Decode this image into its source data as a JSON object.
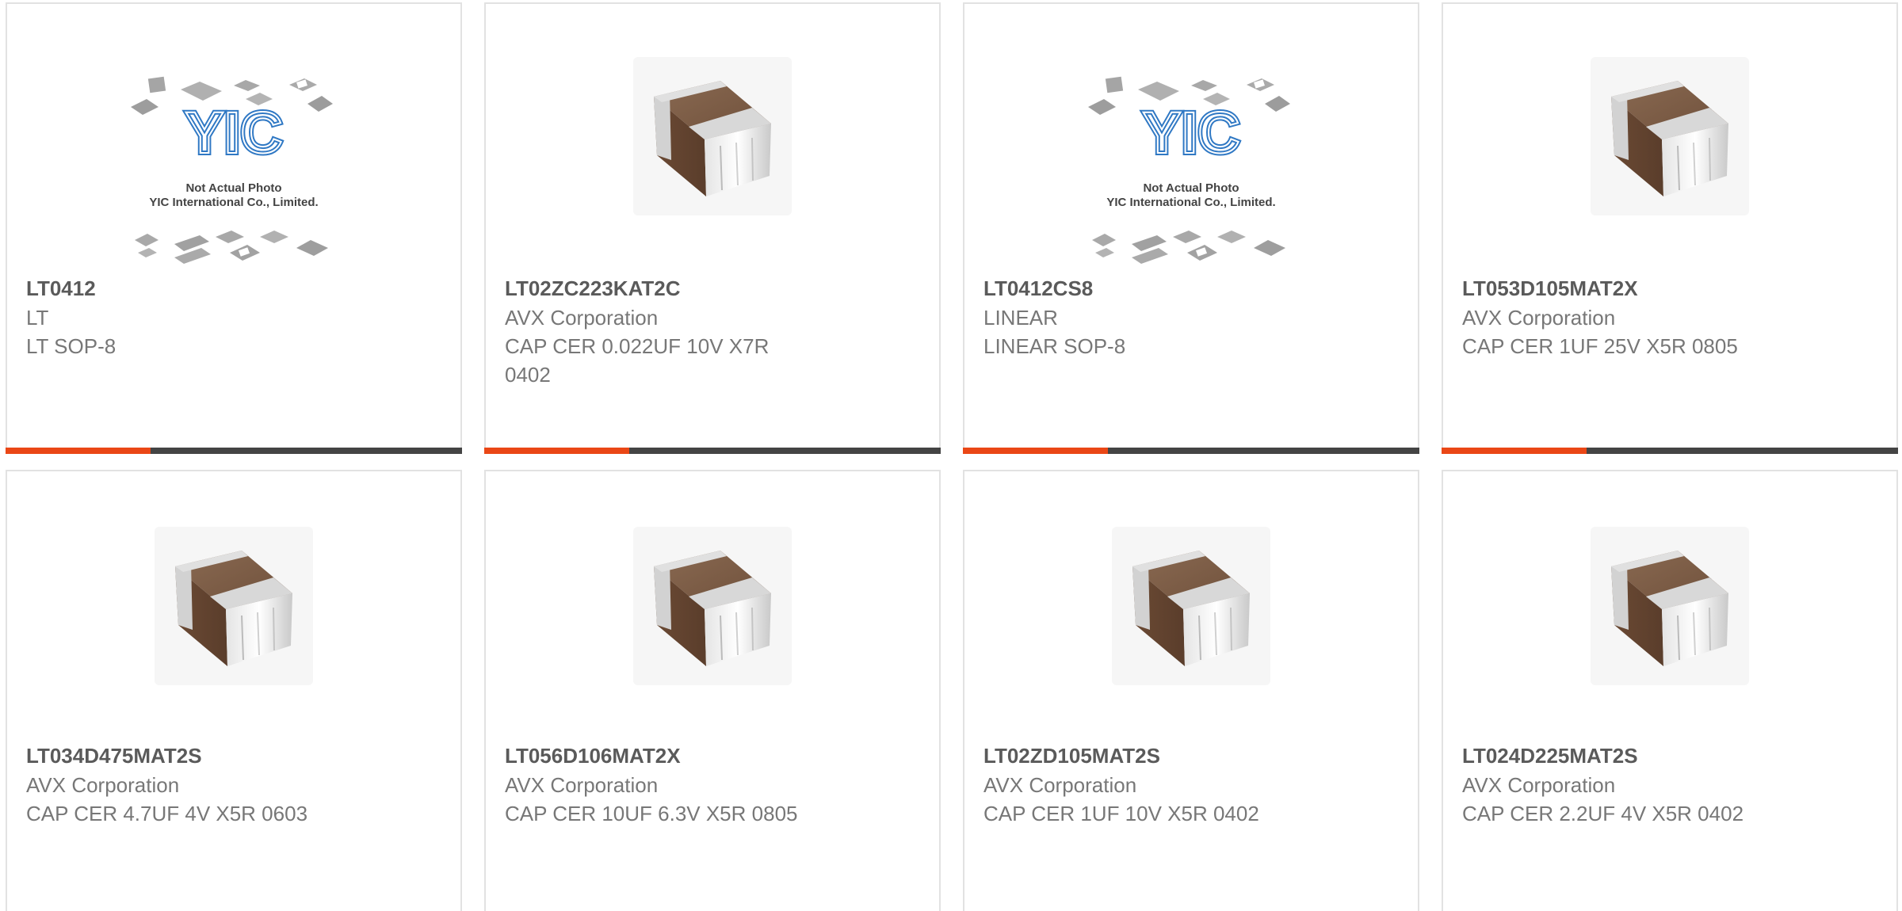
{
  "theme": {
    "accent": "#ea4716",
    "bar": "#444444",
    "border": "#e2e2e2",
    "part_text": "#5a5a5a",
    "body_text": "#777777"
  },
  "products": [
    {
      "part": "LT0412",
      "maker": "LT",
      "desc": "LT SOP-8",
      "image": "yic-not-actual-photo",
      "photo_caption_1": "Not Actual Photo",
      "photo_caption_2": "YIC International Co., Limited."
    },
    {
      "part": "LT02ZC223KAT2C",
      "maker": "AVX Corporation",
      "desc": "CAP CER 0.022UF 10V X7R 0402",
      "image": "ceramic-capacitor"
    },
    {
      "part": "LT0412CS8",
      "maker": "LINEAR",
      "desc": "LINEAR SOP-8",
      "image": "yic-not-actual-photo",
      "photo_caption_1": "Not Actual Photo",
      "photo_caption_2": "YIC International Co., Limited."
    },
    {
      "part": "LT053D105MAT2X",
      "maker": "AVX Corporation",
      "desc": "CAP CER 1UF 25V X5R 0805",
      "image": "ceramic-capacitor"
    },
    {
      "part": "LT034D475MAT2S",
      "maker": "AVX Corporation",
      "desc": "CAP CER 4.7UF 4V X5R 0603",
      "image": "ceramic-capacitor"
    },
    {
      "part": "LT056D106MAT2X",
      "maker": "AVX Corporation",
      "desc": "CAP CER 10UF 6.3V X5R 0805",
      "image": "ceramic-capacitor"
    },
    {
      "part": "LT02ZD105MAT2S",
      "maker": "AVX Corporation",
      "desc": "CAP CER 1UF 10V X5R 0402",
      "image": "ceramic-capacitor"
    },
    {
      "part": "LT024D225MAT2S",
      "maker": "AVX Corporation",
      "desc": "CAP CER 2.2UF 4V X5R 0402",
      "image": "ceramic-capacitor"
    }
  ]
}
